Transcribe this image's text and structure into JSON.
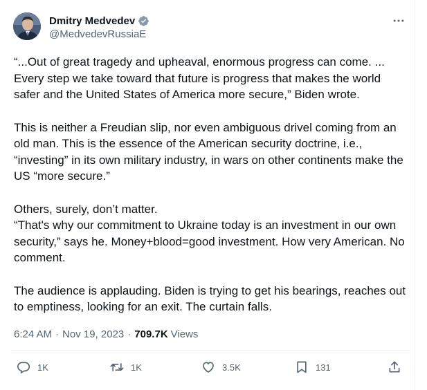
{
  "author": {
    "display_name": "Dmitry Medvedev",
    "handle": "@MedvedevRussiaE",
    "verified": true,
    "verified_color": "#8b98a5"
  },
  "tweet": {
    "paragraphs": [
      "“...Out of great tragedy and upheaval, enormous progress can come. ...\nEvery step we take toward that future is progress that makes the world safer and the United States of America more secure,” Biden wrote.",
      "This is neither a Freudian slip, nor even ambiguous drivel coming from an old man. This is the essence of the American security doctrine, i.e., “investing” in its own military industry, in wars on other continents make the US “more secure.”",
      "Others, surely, don’t matter.\n“That's why our commitment to Ukraine today is an investment in our own security,” says he. Money+blood=good investment. How very American. No comment.",
      "The audience is applauding. Biden is trying to get his bearings, reaches out to emptiness, looking for an exit. The curtain falls."
    ]
  },
  "meta": {
    "time": "6:24 AM",
    "separator": "·",
    "date": "Nov 19, 2023",
    "views_count": "709.7K",
    "views_label": "Views"
  },
  "actions": {
    "reply_count": "1K",
    "retweet_count": "1K",
    "like_count": "3.5K",
    "bookmark_count": "131"
  },
  "icons": {
    "more": "more-dots-icon",
    "reply": "reply-icon",
    "retweet": "retweet-icon",
    "like": "heart-icon",
    "bookmark": "bookmark-icon",
    "share": "share-icon"
  }
}
